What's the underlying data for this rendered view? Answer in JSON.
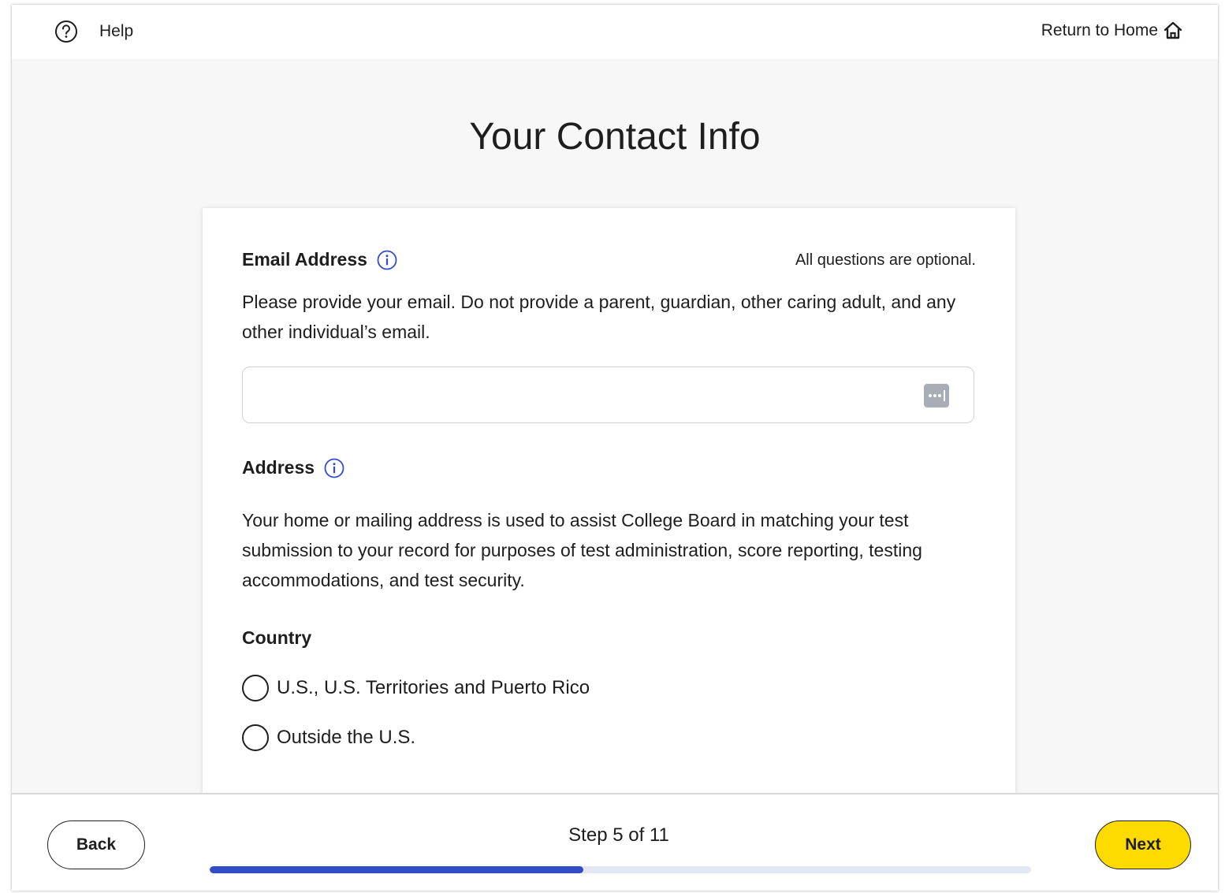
{
  "header": {
    "help_label": "Help",
    "home_label": "Return to Home"
  },
  "page": {
    "title": "Your Contact Info",
    "optional_note": "All questions are optional."
  },
  "email": {
    "label": "Email Address",
    "description": "Please provide your email. Do not provide a parent, guardian, other caring adult, and any other individual’s email.",
    "value": "",
    "placeholder": ""
  },
  "address": {
    "label": "Address",
    "description": "Your home or mailing address is used to assist College Board in matching your test submission to your record for purposes of test administration, score reporting, testing accommodations, and test security."
  },
  "country": {
    "label": "Country",
    "options": [
      {
        "label": "U.S., U.S. Territories and Puerto Rico",
        "selected": false
      },
      {
        "label": "Outside the U.S.",
        "selected": false
      }
    ]
  },
  "footer": {
    "back_label": "Back",
    "next_label": "Next",
    "step_text": "Step 5 of 11",
    "progress_fraction": 0.4545
  },
  "colors": {
    "accent_blue": "#324dc7",
    "next_yellow": "#fedb00",
    "track": "#e4e8f5"
  },
  "icons": {
    "help": "help-circle-icon",
    "home": "home-icon",
    "info": "info-icon",
    "autofill": "autofill-icon"
  }
}
